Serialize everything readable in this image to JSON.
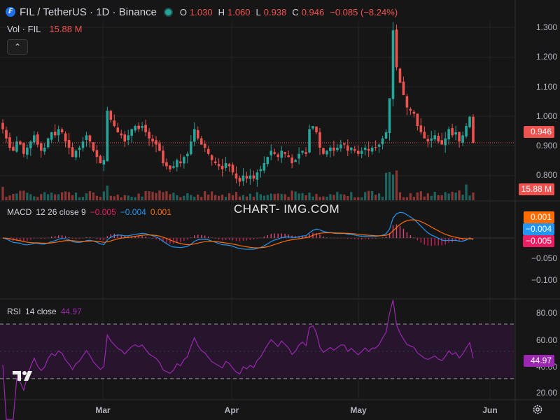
{
  "header": {
    "coin_glyph": "₣",
    "symbol": "FIL / TetherUS · 1D · Binance",
    "ohlc": [
      {
        "key": "O",
        "value": "1.030"
      },
      {
        "key": "H",
        "value": "1.060"
      },
      {
        "key": "L",
        "value": "0.938"
      },
      {
        "key": "C",
        "value": "0.946"
      }
    ],
    "change": "−0.085 (−8.24%)"
  },
  "volume_legend": {
    "label": "Vol · FIL",
    "value": "15.88 M"
  },
  "collapse_glyph": "⌃",
  "watermark": "CHART- IMG.COM",
  "macd_legend": {
    "name": "MACD",
    "params": "12 26 close 9",
    "hist": "−0.005",
    "macd": "−0.004",
    "signal": "0.001"
  },
  "rsi_legend": {
    "name": "RSI",
    "params": "14 close",
    "value": "44.97"
  },
  "price_axis": [
    "1.300",
    "1.200",
    "1.100",
    "1.000",
    "0.900",
    "0.800"
  ],
  "macd_axis": [
    "−0.050",
    "−0.100"
  ],
  "rsi_axis": [
    "80.00",
    "60.00",
    "40.00",
    "20.00"
  ],
  "time_axis": [
    "Mar",
    "Apr",
    "May",
    "Jun"
  ],
  "tags": {
    "price": "0.946",
    "volume": "15.88 M",
    "macd_signal": "0.001",
    "macd_line": "−0.004",
    "macd_hist": "−0.005",
    "rsi": "44.97"
  },
  "colors": {
    "up": "#26a69a",
    "down": "#ef5350",
    "macd": "#2196f3",
    "signal": "#ff6d00",
    "rsi": "#9c27b0",
    "hist": "#e91e63"
  },
  "chart_data": [
    {
      "type": "candlestick",
      "title": "FIL / TetherUS · 1D · Binance",
      "x_ticks": [
        "Mar",
        "Apr",
        "May",
        "Jun"
      ],
      "ylim": [
        0.76,
        1.34
      ],
      "closes": [
        0.99,
        0.96,
        0.93,
        0.92,
        0.95,
        0.94,
        0.91,
        0.93,
        0.95,
        0.97,
        0.94,
        0.92,
        0.93,
        0.96,
        0.98,
        0.97,
        0.99,
        0.98,
        0.95,
        0.93,
        0.9,
        0.92,
        0.93,
        0.95,
        0.97,
        0.95,
        0.92,
        0.9,
        0.88,
        0.89,
        1.05,
        1.02,
        1.0,
        0.98,
        0.97,
        0.95,
        0.97,
        0.99,
        1.0,
        0.99,
        1.0,
        0.98,
        0.96,
        0.95,
        0.94,
        0.92,
        0.88,
        0.87,
        0.86,
        0.87,
        0.89,
        0.88,
        0.9,
        0.91,
        0.95,
        0.99,
        0.96,
        0.94,
        0.93,
        0.91,
        0.89,
        0.88,
        0.87,
        0.86,
        0.88,
        0.87,
        0.85,
        0.83,
        0.82,
        0.84,
        0.83,
        0.84,
        0.83,
        0.85,
        0.86,
        0.88,
        0.9,
        0.92,
        0.91,
        0.9,
        0.92,
        0.91,
        0.9,
        0.88,
        0.89,
        0.91,
        0.92,
        0.91,
        0.99,
        1.0,
        0.98,
        0.93,
        0.91,
        0.92,
        0.93,
        0.92,
        0.93,
        0.94,
        0.94,
        0.92,
        0.93,
        0.92,
        0.91,
        0.92,
        0.93,
        0.92,
        0.93,
        0.93,
        0.94,
        0.96,
        0.98,
        1.09,
        1.31,
        1.19,
        1.14,
        1.1,
        1.06,
        1.05,
        1.04,
        1.0,
        0.98,
        0.96,
        0.95,
        0.96,
        0.97,
        0.95,
        0.94,
        0.96,
        0.99,
        0.97,
        0.98,
        0.95,
        0.97,
        1.0,
        1.03,
        0.946
      ],
      "price_line": 0.946,
      "volume_relative_max_label": "15.88 M"
    },
    {
      "type": "line",
      "title": "MACD 12 26 close 9",
      "series": [
        {
          "name": "MACD",
          "last": -0.004
        },
        {
          "name": "Signal",
          "last": 0.001
        },
        {
          "name": "Histogram",
          "last": -0.005
        }
      ],
      "ylim": [
        -0.13,
        0.12
      ],
      "y_ticks": [
        -0.05,
        -0.1
      ]
    },
    {
      "type": "line",
      "title": "RSI 14 close",
      "ylim": [
        15,
        88
      ],
      "y_ticks": [
        80,
        60,
        40,
        20
      ],
      "bands": [
        70,
        30
      ],
      "last": 44.97
    }
  ]
}
